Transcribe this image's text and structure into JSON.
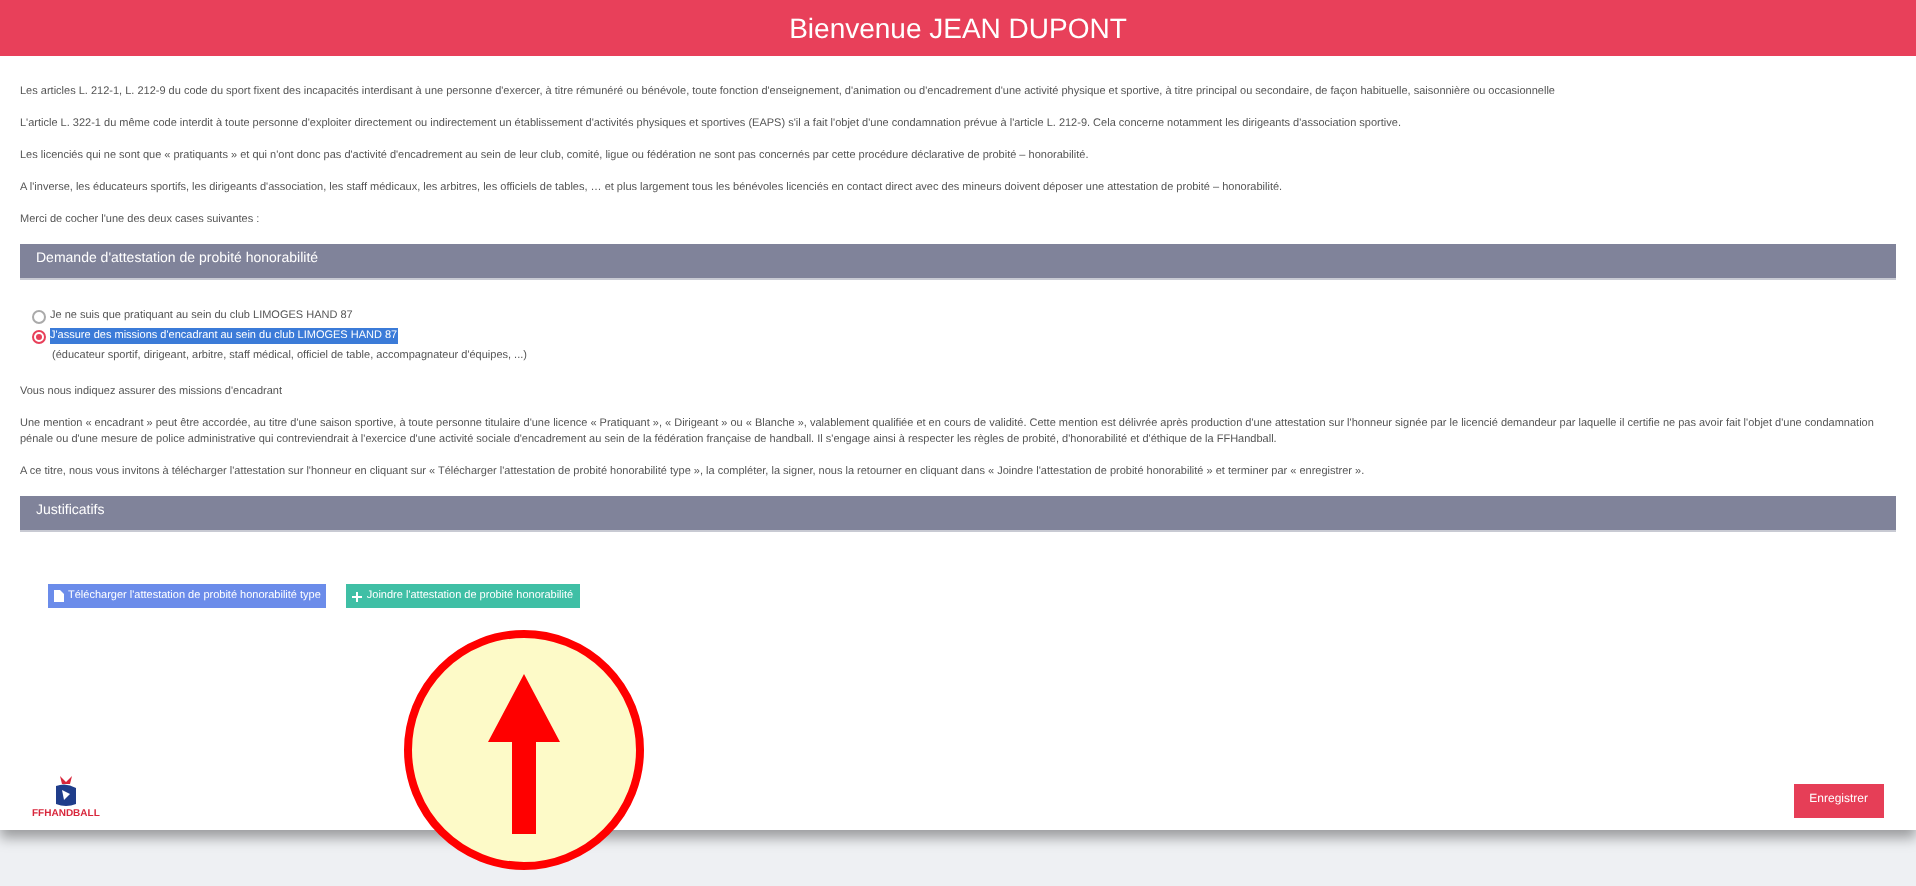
{
  "header": {
    "title": "Bienvenue JEAN DUPONT"
  },
  "intro": [
    "Les articles L. 212-1, L. 212-9 du code du sport fixent des incapacités interdisant à une personne d'exercer, à titre rémunéré ou bénévole, toute fonction d'enseignement, d'animation ou d'encadrement d'une activité physique et sportive, à titre principal ou secondaire, de façon habituelle, saisonnière ou occasionnelle",
    "L'article L. 322-1 du même code interdit à toute personne d'exploiter directement ou indirectement un établissement d'activités physiques et sportives (EAPS) s'il a fait l'objet d'une condamnation prévue à l'article L. 212-9. Cela concerne notamment les dirigeants d'association sportive.",
    "Les licenciés qui ne sont que « pratiquants » et qui n'ont donc pas d'activité d'encadrement au sein de leur club, comité, ligue ou fédération ne sont pas concernés par cette procédure déclarative de probité – honorabilité.",
    "A l'inverse, les éducateurs sportifs, les dirigeants d'association, les staff médicaux, les arbitres, les officiels de tables, … et plus largement tous les bénévoles licenciés en contact direct avec des mineurs doivent déposer une attestation de probité – honorabilité.",
    "Merci de cocher l'une des deux cases suivantes :"
  ],
  "request": {
    "title": "Demande d'attestation de probité honorabilité",
    "options": [
      {
        "label": "Je ne suis que pratiquant au sein du club LIMOGES HAND 87",
        "selected": false
      },
      {
        "label": "J'assure des missions d'encadrant au sein du club LIMOGES HAND 87",
        "selected": true,
        "note": "(éducateur sportif, dirigeant, arbitre, staff médical, officiel de table, accompagnateur d'équipes, ...)"
      }
    ],
    "statement": "Vous nous indiquez assurer des missions d'encadrant",
    "paragraphs": [
      "Une mention « encadrant » peut être accordée, au titre d'une saison sportive, à toute personne titulaire d'une licence « Pratiquant », « Dirigeant » ou « Blanche », valablement qualifiée et en cours de validité. Cette mention est délivrée après production d'une attestation sur l'honneur signée par le licencié demandeur par laquelle il certifie ne pas avoir fait l'objet d'une condamnation pénale ou d'une mesure de police administrative qui contreviendrait à l'exercice d'une activité sociale d'encadrement au sein de la fédération française de handball. Il s'engage ainsi à respecter les règles de probité, d'honorabilité et d'éthique de la FFHandball.",
      "A ce titre, nous vous invitons à télécharger l'attestation sur l'honneur en cliquant sur « Télécharger l'attestation de probité honorabilité type », la compléter, la signer, nous la retourner en cliquant dans « Joindre l'attestation de probité honorabilité » et terminer par « enregistrer »."
    ]
  },
  "documents": {
    "title": "Justificatifs",
    "buttons": [
      {
        "label": "Télécharger l'attestation de probité honorabilité type",
        "kind": "download"
      },
      {
        "label": "Joindre l'attestation de probité honorabilité",
        "kind": "attach"
      }
    ]
  },
  "logo": {
    "text": "FFHANDBALL"
  },
  "save_button": {
    "label": "Enregistrer"
  }
}
